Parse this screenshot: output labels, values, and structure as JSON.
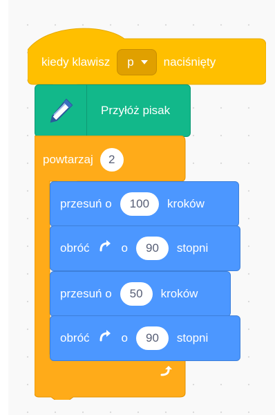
{
  "hat_block": {
    "label_before": "kiedy klawisz",
    "key_value": "p",
    "label_after": "naciśnięty"
  },
  "pen_block": {
    "label": "Przyłóż pisak",
    "icon": "pen-icon"
  },
  "repeat_block": {
    "label": "powtarzaj",
    "times": "2"
  },
  "motion_blocks": [
    {
      "type": "move",
      "prefix": "przesuń o",
      "value": "100",
      "suffix": "kroków"
    },
    {
      "type": "turn",
      "prefix": "obróć",
      "icon": "rotate-clockwise-icon",
      "mid": "o",
      "value": "90",
      "suffix": "stopni"
    },
    {
      "type": "move",
      "prefix": "przesuń o",
      "value": "50",
      "suffix": "kroków"
    },
    {
      "type": "turn",
      "prefix": "obróć",
      "icon": "rotate-clockwise-icon",
      "mid": "o",
      "value": "90",
      "suffix": "stopni"
    }
  ],
  "colors": {
    "events": "#ffbf00",
    "pen": "#0fbd8c",
    "control": "#ffab19",
    "motion": "#4c97ff"
  }
}
